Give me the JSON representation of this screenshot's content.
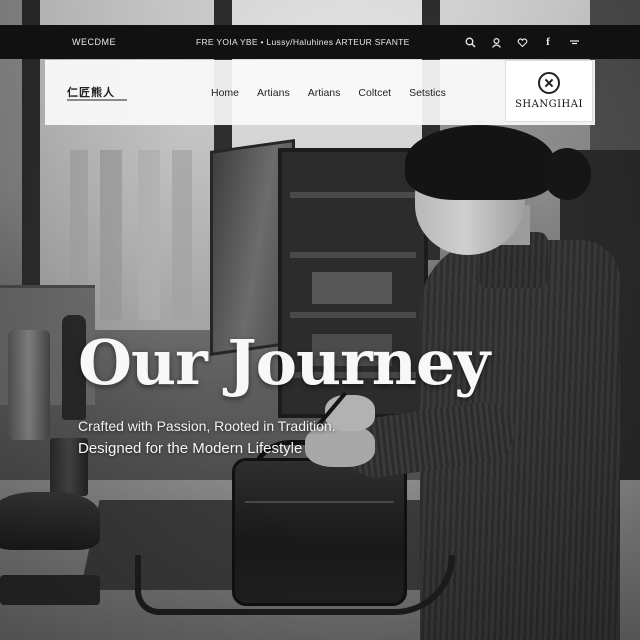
{
  "topbar": {
    "welcome": "WECDME",
    "promo": "FRE YOIA YBE • Lussy/Haluhines ARTEUR SFANTE",
    "icons": [
      "search-icon",
      "user-icon",
      "wishlist-icon",
      "facebook-icon",
      "menu-icon"
    ]
  },
  "nav": {
    "brand": "仁匠熊人",
    "links": [
      {
        "label": "Home"
      },
      {
        "label": "Artians"
      },
      {
        "label": "Artians"
      },
      {
        "label": "Coltcet"
      },
      {
        "label": "Setstics"
      }
    ],
    "logo_text": "SHANGIHAI"
  },
  "hero": {
    "headline": "Our Journey",
    "tagline_line1": "Crafted with Passion, Rooted in Tradition.",
    "tagline_line2": "Designed for the Modern Lifestyle"
  },
  "colors": {
    "topbar_bg": "#111111",
    "nav_bg": "#fafafa",
    "headline": "#f8f8f8"
  }
}
